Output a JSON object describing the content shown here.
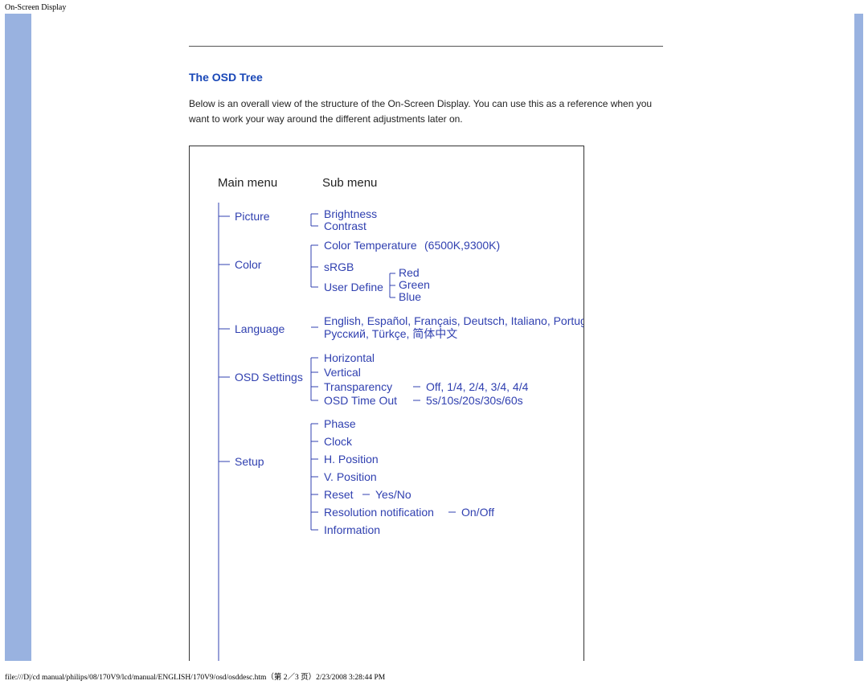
{
  "title_top": "On-Screen Display",
  "section_heading": "The OSD Tree",
  "body_paragraph": "Below is an overall view of the structure of the On-Screen Display. You can use this as a reference when you want to work your way around the different adjustments later on.",
  "header_main": "Main menu",
  "header_sub": "Sub menu",
  "main": {
    "picture": "Picture",
    "color": "Color",
    "language": "Language",
    "osd_settings": "OSD Settings",
    "setup": "Setup"
  },
  "picture_sub": {
    "brightness": "Brightness",
    "contrast": "Contrast"
  },
  "color_sub": {
    "color_temp": "Color Temperature",
    "color_temp_opts": "(6500K,9300K)",
    "srgb": "sRGB",
    "user_define": "User Define",
    "red": "Red",
    "green": "Green",
    "blue": "Blue"
  },
  "language_sub": {
    "line1": "English, Español, Français, Deutsch, Italiano, Português,",
    "line2": "Русский, Türkçe, 简体中文"
  },
  "osd_settings_sub": {
    "horizontal": "Horizontal",
    "vertical": "Vertical",
    "transparency": "Transparency",
    "transparency_opts": "Off, 1/4, 2/4, 3/4, 4/4",
    "osd_timeout": "OSD Time Out",
    "osd_timeout_opts": "5s/10s/20s/30s/60s"
  },
  "setup_sub": {
    "phase": "Phase",
    "clock": "Clock",
    "h_pos": "H. Position",
    "v_pos": "V. Position",
    "reset": "Reset",
    "reset_opts": "Yes/No",
    "res_notif": "Resolution notification",
    "res_notif_opts": "On/Off",
    "information": "Information"
  },
  "footer": "file:///D|/cd manual/philips/08/170V9/lcd/manual/ENGLISH/170V9/osd/osddesc.htm（第 2／3 页）2/23/2008 3:28:44 PM"
}
